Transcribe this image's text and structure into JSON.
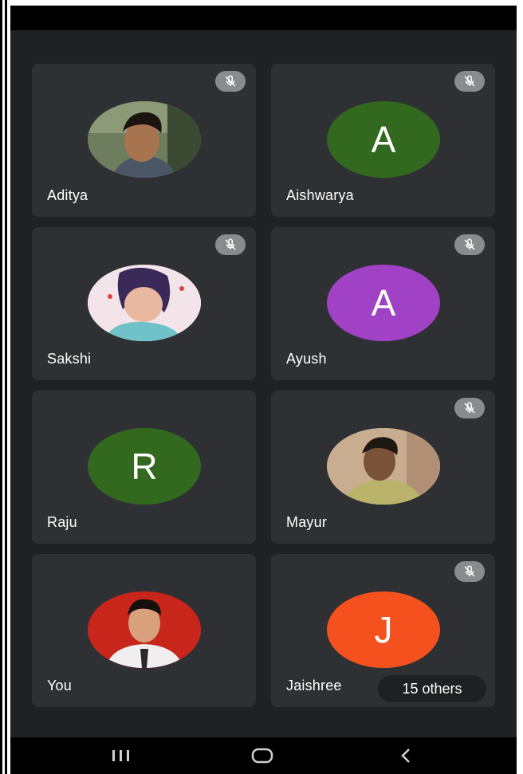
{
  "participants": [
    {
      "name": "Aditya",
      "avatar_type": "photo",
      "muted": true
    },
    {
      "name": "Aishwarya",
      "avatar_type": "letter",
      "letter": "A",
      "color": "#33691e",
      "muted": true
    },
    {
      "name": "Sakshi",
      "avatar_type": "photo",
      "muted": true
    },
    {
      "name": "Ayush",
      "avatar_type": "letter",
      "letter": "A",
      "color": "#a142c6",
      "muted": true
    },
    {
      "name": "Raju",
      "avatar_type": "letter",
      "letter": "R",
      "color": "#33691e",
      "muted": false
    },
    {
      "name": "Mayur",
      "avatar_type": "photo",
      "muted": true
    },
    {
      "name": "You",
      "avatar_type": "photo",
      "muted": false
    },
    {
      "name": "Jaishree",
      "avatar_type": "letter",
      "letter": "J",
      "color": "#f4511e",
      "muted": true
    }
  ],
  "others_label": "15 others",
  "icons": {
    "mute": "mic-off-icon",
    "recents": "recent-apps-icon",
    "home": "home-icon",
    "back": "back-icon"
  },
  "colors": {
    "background": "#202124",
    "tile": "#2f3033",
    "mute_badge": "#8a8b8e"
  }
}
